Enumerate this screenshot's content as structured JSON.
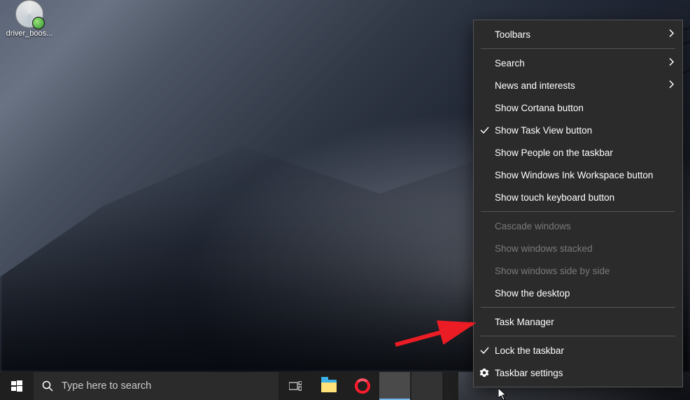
{
  "desktop_icon": {
    "label": "driver_boos..."
  },
  "taskbar": {
    "search_placeholder": "Type here to search"
  },
  "context_menu": {
    "items": [
      {
        "label": "Toolbars",
        "submenu": true
      },
      {
        "sep": true
      },
      {
        "label": "Search",
        "submenu": true
      },
      {
        "label": "News and interests",
        "submenu": true
      },
      {
        "label": "Show Cortana button"
      },
      {
        "label": "Show Task View button",
        "checked": true
      },
      {
        "label": "Show People on the taskbar"
      },
      {
        "label": "Show Windows Ink Workspace button"
      },
      {
        "label": "Show touch keyboard button"
      },
      {
        "sep": true
      },
      {
        "label": "Cascade windows",
        "disabled": true
      },
      {
        "label": "Show windows stacked",
        "disabled": true
      },
      {
        "label": "Show windows side by side",
        "disabled": true
      },
      {
        "label": "Show the desktop"
      },
      {
        "sep": true
      },
      {
        "label": "Task Manager"
      },
      {
        "sep": true
      },
      {
        "label": "Lock the taskbar",
        "checked": true
      },
      {
        "label": "Taskbar settings",
        "gear": true
      }
    ]
  }
}
